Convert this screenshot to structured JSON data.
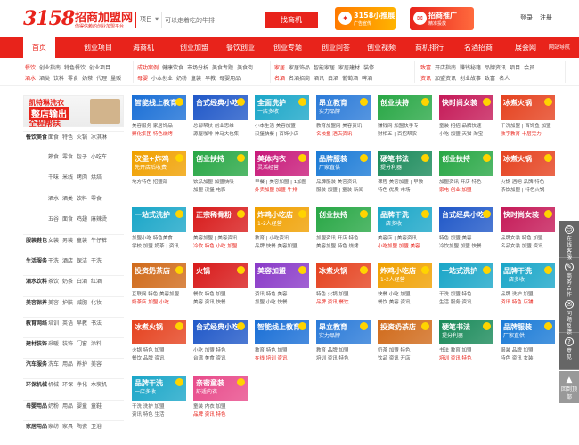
{
  "header": {
    "logo_num": "3158",
    "logo_name": "招商加盟网",
    "logo_slogan": "值得信赖的创业加盟平台",
    "search_type": "项目",
    "search_placeholder": "可以走着吃的牛排",
    "search_button": "找商机",
    "badge1_title": "3158小推展",
    "badge1_sub": "广告宣传",
    "badge2_title": "招商推广",
    "badge2_sub": "精准投放",
    "login": "登录",
    "register": "注册"
  },
  "nav": {
    "items": [
      "首页",
      "创业项目",
      "海商机",
      "创业加盟",
      "餐饮创业",
      "创业专题",
      "创业问答",
      "创业视频",
      "商机排行",
      "名酒招商",
      "展会网"
    ],
    "right": "网站导航"
  },
  "cats": {
    "b1l1": [
      "餐饮",
      "创业指南",
      "特色餐饮",
      "创业项目"
    ],
    "b1l2": [
      "酒水",
      "酒类",
      "饮料",
      "零食",
      "奶茶",
      "代理",
      "量贩"
    ],
    "b2l1": [
      "成功案例",
      "健康饮食",
      "市场分析",
      "美食专题",
      "美食街"
    ],
    "b2l2": [
      "母婴",
      "小本创业",
      "奶粉",
      "童装",
      "早教",
      "母婴用品"
    ],
    "b3l1": [
      "家居",
      "家居饰品",
      "智能家居",
      "家居建材",
      "装修"
    ],
    "b3l2": [
      "名酒",
      "名酒招商",
      "酒讯",
      "白酒",
      "葡萄酒",
      "啤酒"
    ],
    "b4l1": [
      "致富",
      "开店指南",
      "赚钱秘籍",
      "品牌资讯",
      "项目",
      "会员"
    ],
    "b4l2": [
      "资讯",
      "加盟资讯",
      "创业故事",
      "致富",
      "名人"
    ]
  },
  "sidebar": {
    "promo1": "凯特琳洗衣",
    "promo2": "整店输出",
    "promo3": "全程帮扶",
    "rows": [
      {
        "head": "餐饮美食",
        "items": [
          "面食",
          "特色",
          "火锅",
          "冰淇淋"
        ]
      },
      {
        "head": "",
        "items": [
          "",
          "熟食",
          "零食",
          "包子",
          "小吃车"
        ]
      },
      {
        "head": "",
        "items": [
          "",
          "千味",
          "米线",
          "烤肉",
          "烘焙"
        ]
      },
      {
        "head": "",
        "items": [
          "",
          "酒水",
          "酒类",
          "饮料",
          "零食"
        ]
      },
      {
        "head": "",
        "items": [
          "",
          "五谷",
          "面食",
          "鸡翅",
          "麻辣烫"
        ]
      },
      {
        "head": "服装鞋包",
        "items": [
          "女装",
          "男装",
          "童装",
          "牛仔裤"
        ]
      },
      {
        "head": "生活服务",
        "items": [
          "干洗",
          "酒店",
          "保洁",
          "干洗"
        ]
      },
      {
        "head": "酒水饮料",
        "items": [
          "茶饮",
          "奶茶",
          "白酒",
          "红酒"
        ]
      },
      {
        "head": "美容保养",
        "items": [
          "美容",
          "护肤",
          "减肥",
          "化妆"
        ]
      },
      {
        "head": "教育网络",
        "items": [
          "培训",
          "英语",
          "早教",
          "书法"
        ]
      },
      {
        "head": "建材装饰",
        "items": [
          "采暖",
          "装饰",
          "门窗",
          "涂料"
        ]
      },
      {
        "head": "汽车服务",
        "items": [
          "洗车",
          "用品",
          "养护",
          "美容"
        ]
      },
      {
        "head": "环保机械",
        "items": [
          "机械",
          "环保",
          "净化",
          "木炭机"
        ]
      },
      {
        "head": "母婴用品",
        "items": [
          "奶粉",
          "用品",
          "婴童",
          "童鞋"
        ]
      },
      {
        "head": "家居用品",
        "items": [
          "家纺",
          "家具",
          "陶瓷",
          "卫浴"
        ]
      }
    ]
  },
  "cards": [
    {
      "ad1": "智能线上教育",
      "ad2": "",
      "c": "#1a6fd6",
      "l1": "美容服务 家居饰品",
      "l2": "孵化集团 特色烧烤"
    },
    {
      "ad1": "台式经典小吃",
      "ad2": "",
      "c": "#2058c8",
      "l1": "总部帮扶 创业思维",
      "l2": "源屋咖啡 神马大包集"
    },
    {
      "ad1": "全面洗护",
      "ad2": "一店多收",
      "c": "#1aa6c8",
      "l1": "小本生活 美容加盟",
      "l2": "汉堡快餐 | 百饰小店"
    },
    {
      "ad1": "昂立教育",
      "ad2": "实力品牌",
      "c": "#2a7ad8",
      "l1": "教育加盟网 美容资讯",
      "l2": "名校鱼 酒店资讯"
    },
    {
      "ad1": "创业扶持",
      "ad2": "",
      "c": "#28a745",
      "l1": "赚钱网 加盟快手专",
      "l2": "财相五 | 百招帮农"
    },
    {
      "ad1": "快时尚女装",
      "ad2": "",
      "c": "#c51a58",
      "l1": "童装 招招 品牌快速",
      "l2": "小吃 加盟 天猫 淘宝"
    },
    {
      "ad1": "冰煮火锅",
      "ad2": "",
      "c": "#e5421f",
      "l1": "干洗加盟 | 百饰鱼 加盟",
      "l2": "数字教育 十层完力"
    },
    {
      "ad1": "汉堡+炸鸡",
      "ad2": "先开店后收费",
      "c": "#f0a000",
      "l1": "地方特色 招盟部"
    },
    {
      "ad1": "创业扶持",
      "ad2": "",
      "c": "#28a745",
      "l1": "饮品加盟 加盟快吸",
      "l2": "加盟 汉堡 电影"
    },
    {
      "ad1": "美体内衣",
      "ad2": "灵活经营",
      "c": "#c81a7a",
      "l1": "早餐 | 美容加盟 | 1加盟",
      "l2": "外卖加盟 加盟 牛排"
    },
    {
      "ad1": "品牌服装",
      "ad2": "厂家直供",
      "c": "#1a7ad6",
      "l1": "品牌服装 美容资讯",
      "l2": "服装 加盟 | 童装 新闻"
    },
    {
      "ad1": "硬笔书法",
      "ad2": "提分利器",
      "c": "#1a8a5a",
      "l1": "课程 美容加盟 | 早教",
      "l2": "特色 优质 市场"
    },
    {
      "ad1": "创业扶持",
      "ad2": "",
      "c": "#28a745",
      "l1": "加盟资讯 开店 特色",
      "l2": "家电 创业 加盟"
    },
    {
      "ad1": "冰煮火锅",
      "ad2": "",
      "c": "#e5421f",
      "l1": "火锅 酒吧 品牌 特色",
      "l2": "茶饮加盟 | 特色火锅"
    },
    {
      "ad1": "一站式洗护",
      "ad2": "",
      "c": "#1aa6c8",
      "l1": "加盟小吃 特色美食",
      "l2": "学校 加盟 奶茶 | 资讯"
    },
    {
      "ad1": "正宗稀骨粉",
      "ad2": "",
      "c": "#d81b1b",
      "l1": "美容加盟 | 美容资讯",
      "l2": "冷饮 特色 小吃 加盟"
    },
    {
      "ad1": "炸鸡小吃店",
      "ad2": "1-2人经营",
      "c": "#f0a000",
      "l1": "教育 | 小吃资讯",
      "l2": "品牌 快餐 美容加盟"
    },
    {
      "ad1": "创业扶持",
      "ad2": "",
      "c": "#28a745",
      "l1": "加盟资讯 开店 特色",
      "l2": "美容加盟 特色 烧烤"
    },
    {
      "ad1": "品牌干洗",
      "ad2": "一店多收",
      "c": "#1aa6c8",
      "l1": "美容店 | 美容资讯",
      "l2": "小吃加盟 加盟 美容"
    },
    {
      "ad1": "台式经典小吃",
      "ad2": "",
      "c": "#2058c8",
      "l1": "特色 加盟 美容",
      "l2": "冷饮加盟 加盟 快餐"
    },
    {
      "ad1": "快时尚女装",
      "ad2": "",
      "c": "#c51a58",
      "l1": "品牌女装 特色 加盟",
      "l2": "名品女装 加盟 资讯"
    },
    {
      "ad1": "投资奶茶店",
      "ad2": "",
      "c": "#d06a1a",
      "l1": "互联网 特色 美容加盟",
      "l2": "奶茶店 加盟 小吃"
    },
    {
      "ad1": "火锅",
      "ad2": "",
      "c": "#d81b1b",
      "l1": "餐饮 特色 加盟",
      "l2": "美容 资讯 快餐"
    },
    {
      "ad1": "美容加盟",
      "ad2": "",
      "c": "#8a3ac8",
      "l1": "资讯 特色 美容",
      "l2": "加盟 小吃 快餐"
    },
    {
      "ad1": "冰煮火锅",
      "ad2": "",
      "c": "#e5421f",
      "l1": "特色 火锅 加盟",
      "l2": "品牌 资讯 餐饮"
    },
    {
      "ad1": "炸鸡小吃店",
      "ad2": "1-2人经营",
      "c": "#f0a000",
      "l1": "快餐 小吃 加盟",
      "l2": "餐饮 美容 资讯"
    },
    {
      "ad1": "一站式洗护",
      "ad2": "",
      "c": "#1aa6c8",
      "l1": "干洗 加盟 特色",
      "l2": "生活 服务 资讯"
    },
    {
      "ad1": "品牌干洗",
      "ad2": "一店多收",
      "c": "#1aa6c8",
      "l1": "品牌 洗护 加盟",
      "l2": "资讯 特色 店铺"
    },
    {
      "ad1": "冰煮火锅",
      "ad2": "",
      "c": "#e5421f",
      "l1": "火锅 特色 加盟",
      "l2": "餐饮 品牌 资讯"
    },
    {
      "ad1": "台式经典小吃",
      "ad2": "",
      "c": "#2058c8",
      "l1": "小吃 加盟 特色",
      "l2": "台湾 美食 资讯"
    },
    {
      "ad1": "智能线上教育",
      "ad2": "",
      "c": "#1a6fd6",
      "l1": "教育 特色 加盟",
      "l2": "在线 培训 资讯"
    },
    {
      "ad1": "昂立教育",
      "ad2": "实力品牌",
      "c": "#2a7ad8",
      "l1": "教育 品牌 加盟",
      "l2": "培训 资讯 特色"
    },
    {
      "ad1": "投资奶茶店",
      "ad2": "",
      "c": "#d06a1a",
      "l1": "奶茶 加盟 特色",
      "l2": "饮品 资讯 开店"
    },
    {
      "ad1": "硬笔书法",
      "ad2": "提分利器",
      "c": "#1a8a5a",
      "l1": "书法 教育 加盟",
      "l2": "培训 资讯 特色"
    },
    {
      "ad1": "品牌服装",
      "ad2": "厂家直供",
      "c": "#1a7ad6",
      "l1": "服装 品牌 加盟",
      "l2": "特色 资讯 女装"
    },
    {
      "ad1": "品牌干洗",
      "ad2": "一店多收",
      "c": "#1aa6c8",
      "l1": "干洗 洗护 加盟",
      "l2": "资讯 特色 生活"
    },
    {
      "ad1": "亲密童装",
      "ad2": "舒适内衣",
      "c": "#e84a8a",
      "l1": "童装 内衣 加盟",
      "l2": "品牌 资讯 特色"
    }
  ],
  "side_float": {
    "items": [
      "在线客服",
      "商务合作",
      "问题反馈",
      "意见"
    ],
    "up": "回到顶部"
  }
}
